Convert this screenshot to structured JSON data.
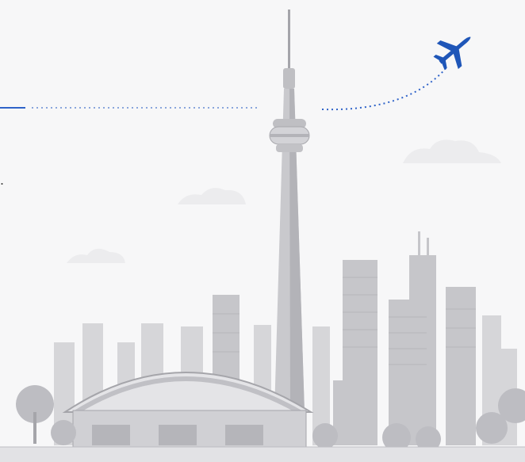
{
  "edge_text": ".",
  "colors": {
    "background": "#f7f7f8",
    "route_line": "#2f63c9",
    "plane": "#1f56b8",
    "skyline_light": "#d6d6d9",
    "skyline_mid": "#bfbfc3",
    "skyline_dark": "#a5a5aa",
    "cloud": "#ececee"
  },
  "icons": {
    "plane": "airplane-icon",
    "tower": "cn-tower-illustration",
    "stadium": "domed-stadium-illustration"
  }
}
